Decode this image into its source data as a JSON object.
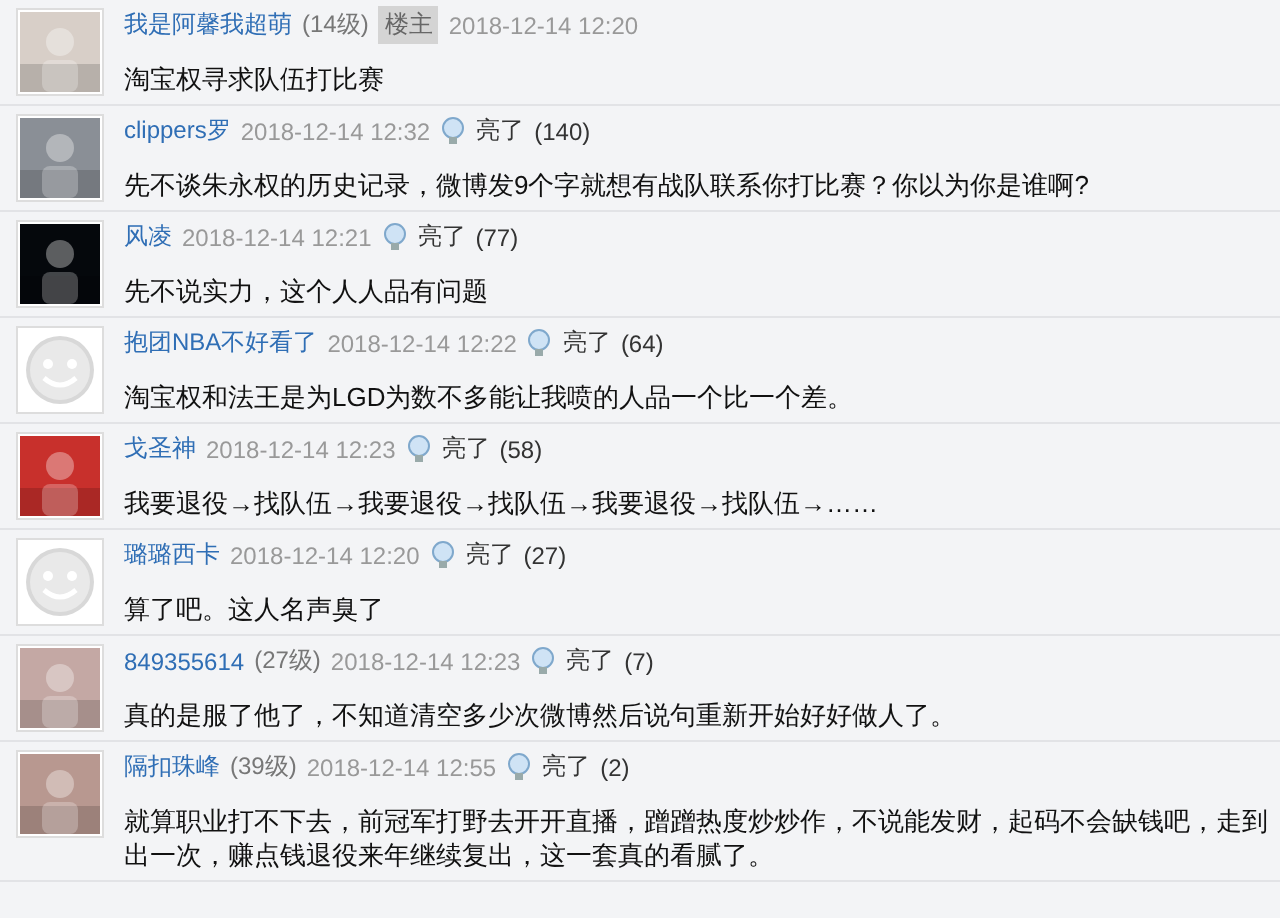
{
  "comments": [
    {
      "name": "我是阿馨我超萌",
      "level": "(14级)",
      "badge": "楼主",
      "time": "2018-12-14 12:20",
      "text": "淘宝权寻求队伍打比赛"
    },
    {
      "name": "clippers罗",
      "time": "2018-12-14 12:32",
      "likes_label": "亮了",
      "likes": "(140)",
      "text": "先不谈朱永权的历史记录，微博发9个字就想有战队联系你打比赛？你以为你是谁啊?"
    },
    {
      "name": "风凌",
      "time": "2018-12-14 12:21",
      "likes_label": "亮了",
      "likes": "(77)",
      "text": "先不说实力，这个人人品有问题"
    },
    {
      "avatar": {
        "kind": "default"
      },
      "name": "抱团NBA不好看了",
      "time": "2018-12-14 12:22",
      "likes_label": "亮了",
      "likes": "(64)",
      "text": "淘宝权和法王是为LGD为数不多能让我喷的人品一个比一个差。"
    },
    {
      "name": "戈圣神",
      "time": "2018-12-14 12:23",
      "likes_label": "亮了",
      "likes": "(58)",
      "text": "我要退役→找队伍→我要退役→找队伍→我要退役→找队伍→……"
    },
    {
      "avatar": {
        "kind": "default"
      },
      "name": "璐璐西卡",
      "time": "2018-12-14 12:20",
      "likes_label": "亮了",
      "likes": "(27)",
      "text": "算了吧。这人名声臭了"
    },
    {
      "name": "849355614",
      "level": "(27级)",
      "time": "2018-12-14 12:23",
      "likes_label": "亮了",
      "likes": "(7)",
      "text": "真的是服了他了，不知道清空多少次微博然后说句重新开始好好做人了。"
    },
    {
      "name": "隔扣珠峰",
      "level": "(39级)",
      "time": "2018-12-14 12:55",
      "likes_label": "亮了",
      "likes": "(2)",
      "text": "就算职业打不下去，前冠军打野去开开直播，蹭蹭热度炒炒作，不说能发财，起码不会缺钱吧，走到出一次，赚点钱退役来年继续复出，这一套真的看腻了。"
    }
  ]
}
